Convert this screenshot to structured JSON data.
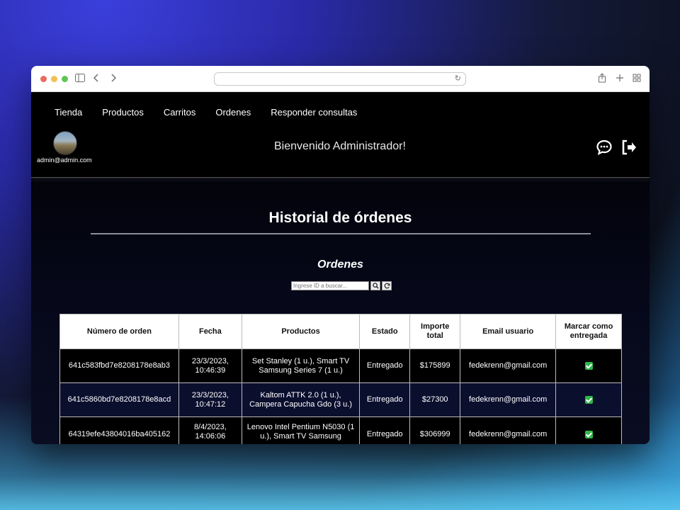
{
  "nav": [
    "Tienda",
    "Productos",
    "Carritos",
    "Ordenes",
    "Responder consultas"
  ],
  "user": {
    "email": "admin@admin.com"
  },
  "header": {
    "welcome": "Bienvenido Administrador!"
  },
  "page": {
    "title": "Historial de órdenes",
    "subtitle": "Ordenes"
  },
  "search": {
    "placeholder": "Ingrese ID a buscar..."
  },
  "table": {
    "headers": [
      "Número de orden",
      "Fecha",
      "Productos",
      "Estado",
      "Importe total",
      "Email usuario",
      "Marcar como entregada"
    ],
    "rows": [
      {
        "id": "641c583fbd7e8208178e8ab3",
        "date": "23/3/2023, 10:46:39",
        "products": "Set Stanley (1 u.), Smart TV Samsung Series 7 (1 u.)",
        "status": "Entregado",
        "total": "$175899",
        "email": "fedekrenn@gmail.com",
        "delivered": true
      },
      {
        "id": "641c5860bd7e8208178e8acd",
        "date": "23/3/2023, 10:47:12",
        "products": "Kaltom ATTK 2.0 (1 u.), Campera Capucha Gdo (3 u.)",
        "status": "Entregado",
        "total": "$27300",
        "email": "fedekrenn@gmail.com",
        "delivered": true
      },
      {
        "id": "64319efe43804016ba405162",
        "date": "8/4/2023, 14:06:06",
        "products": "Lenovo Intel Pentium N5030 (1 u.), Smart TV Samsung",
        "status": "Entregado",
        "total": "$306999",
        "email": "fedekrenn@gmail.com",
        "delivered": true
      }
    ]
  },
  "colors": {
    "check": "#2fb84a",
    "row_alt": "#0b0f2e"
  }
}
